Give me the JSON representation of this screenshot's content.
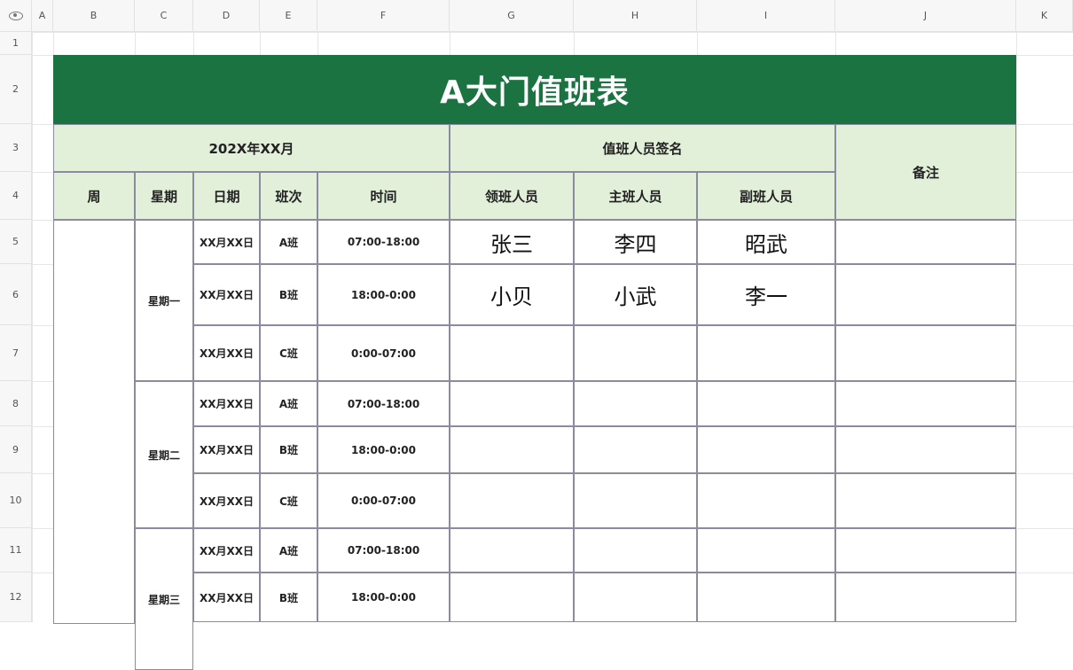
{
  "columns": [
    "A",
    "B",
    "C",
    "D",
    "E",
    "F",
    "G",
    "H",
    "I",
    "J",
    "K"
  ],
  "rows": [
    "1",
    "2",
    "3",
    "4",
    "5",
    "6",
    "7",
    "8",
    "9",
    "10",
    "11",
    "12"
  ],
  "sheet": {
    "title": "A大门值班表",
    "month_header": "202X年XX月",
    "sign_header": "值班人员签名",
    "remark_header": "备注",
    "col_week": "周",
    "col_weekday": "星期",
    "col_date": "日期",
    "col_shift": "班次",
    "col_time": "时间",
    "col_leader": "领班人员",
    "col_main": "主班人员",
    "col_deputy": "副班人员",
    "groups": [
      {
        "weekday": "星期一"
      },
      {
        "weekday": "星期二"
      },
      {
        "weekday": "星期三"
      }
    ],
    "entries": [
      {
        "date": "XX月XX日",
        "shift": "A班",
        "time": "07:00-18:00",
        "leader": "张三",
        "main": "李四",
        "deputy": "昭武",
        "remark": ""
      },
      {
        "date": "XX月XX日",
        "shift": "B班",
        "time": "18:00-0:00",
        "leader": "小贝",
        "main": "小武",
        "deputy": "李一",
        "remark": ""
      },
      {
        "date": "XX月XX日",
        "shift": "C班",
        "time": "0:00-07:00",
        "leader": "",
        "main": "",
        "deputy": "",
        "remark": ""
      },
      {
        "date": "XX月XX日",
        "shift": "A班",
        "time": "07:00-18:00",
        "leader": "",
        "main": "",
        "deputy": "",
        "remark": ""
      },
      {
        "date": "XX月XX日",
        "shift": "B班",
        "time": "18:00-0:00",
        "leader": "",
        "main": "",
        "deputy": "",
        "remark": ""
      },
      {
        "date": "XX月XX日",
        "shift": "C班",
        "time": "0:00-07:00",
        "leader": "",
        "main": "",
        "deputy": "",
        "remark": ""
      },
      {
        "date": "XX月XX日",
        "shift": "A班",
        "time": "07:00-18:00",
        "leader": "",
        "main": "",
        "deputy": "",
        "remark": ""
      },
      {
        "date": "XX月XX日",
        "shift": "B班",
        "time": "18:00-0:00",
        "leader": "",
        "main": "",
        "deputy": "",
        "remark": ""
      }
    ]
  },
  "colors": {
    "title_bg": "#1b7342",
    "header_bg": "#e2efd9",
    "border": "#8a8aa0"
  }
}
